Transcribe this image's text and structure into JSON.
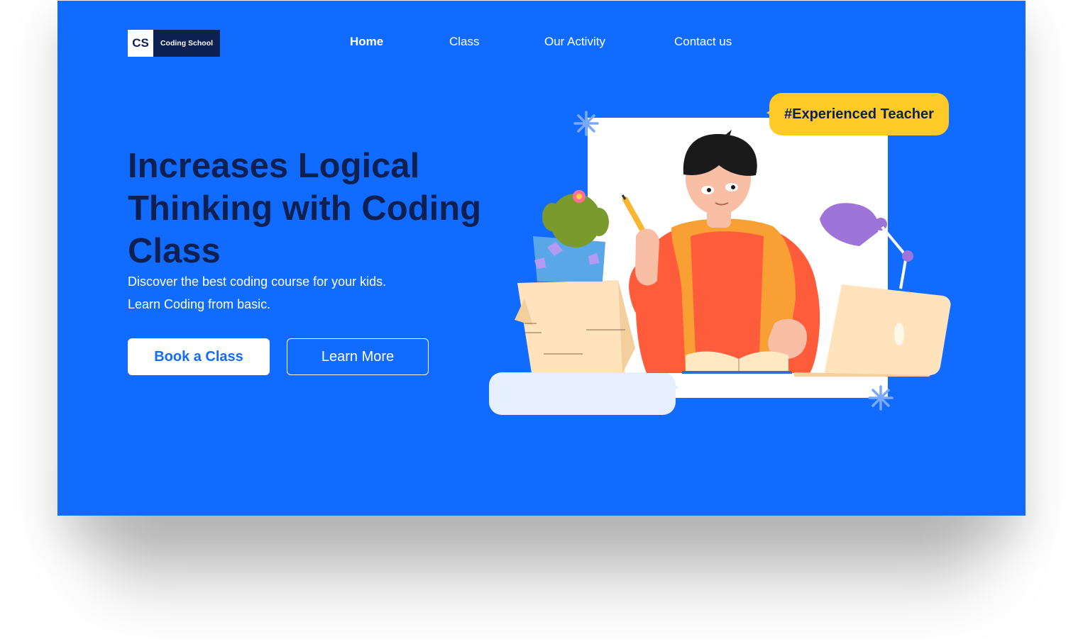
{
  "brand": {
    "mark": "CS",
    "name": "Coding School"
  },
  "nav": {
    "items": [
      {
        "label": "Home",
        "active": true
      },
      {
        "label": "Class",
        "active": false
      },
      {
        "label": "Our Activity",
        "active": false
      },
      {
        "label": "Contact us",
        "active": false
      }
    ]
  },
  "hero": {
    "headline": "Increases Logical Thinking with Coding Class",
    "subtitle_line1": "Discover the best coding course for your kids.",
    "subtitle_line2": "Learn Coding from basic.",
    "primary_button": "Book a Class",
    "secondary_button": "Learn More"
  },
  "illustration": {
    "tag": "#Experienced Teacher",
    "icons": [
      "sparkle-icon",
      "cactus-icon",
      "desk-lamp-icon",
      "laptop-icon",
      "pencil-icon",
      "book-icon",
      "paper-stack-icon"
    ]
  },
  "colors": {
    "background": "#126bff",
    "headline": "#0c2151",
    "tag": "#ffc928",
    "bubble": "#e6efff"
  }
}
